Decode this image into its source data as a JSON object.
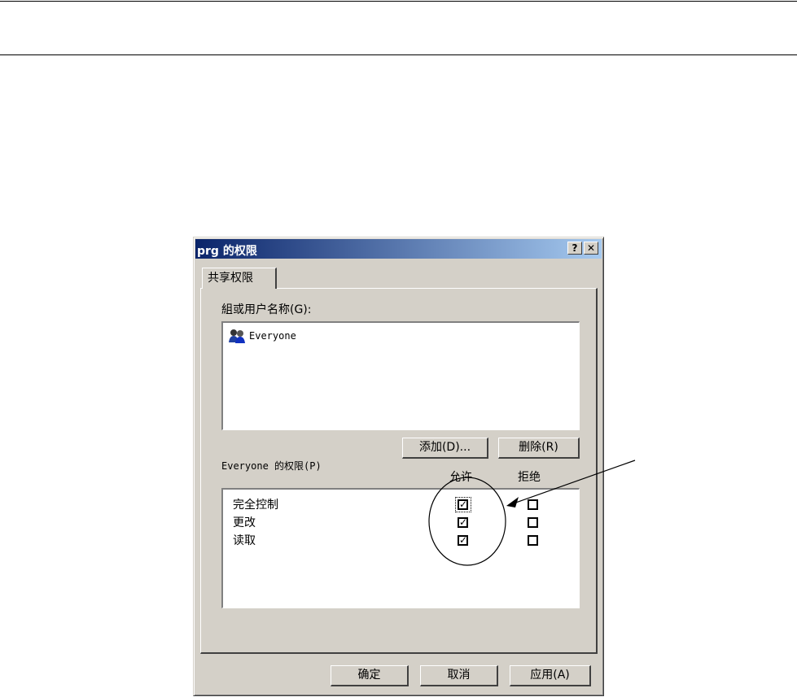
{
  "dialog": {
    "title": "prg 的权限",
    "help_glyph": "?",
    "close_glyph": "✕",
    "tab_label": "共享权限",
    "groups_label": "組或用户名称(G):",
    "users": [
      "Everyone"
    ],
    "add_button": "添加(D)...",
    "remove_button": "删除(R)",
    "permissions_label": "Everyone 的权限(P)",
    "columns": {
      "allow": "允许",
      "deny": "拒绝"
    },
    "permissions": [
      {
        "name": "完全控制",
        "allow": true,
        "deny": false
      },
      {
        "name": "更改",
        "allow": true,
        "deny": false
      },
      {
        "name": "读取",
        "allow": true,
        "deny": false
      }
    ],
    "check_glyph": "✓",
    "ok_button": "确定",
    "cancel_button": "取消",
    "apply_button": "应用(A)"
  },
  "colors": {
    "face": "#d4d0c8",
    "title_start": "#0a246a",
    "title_end": "#a6caf0"
  }
}
